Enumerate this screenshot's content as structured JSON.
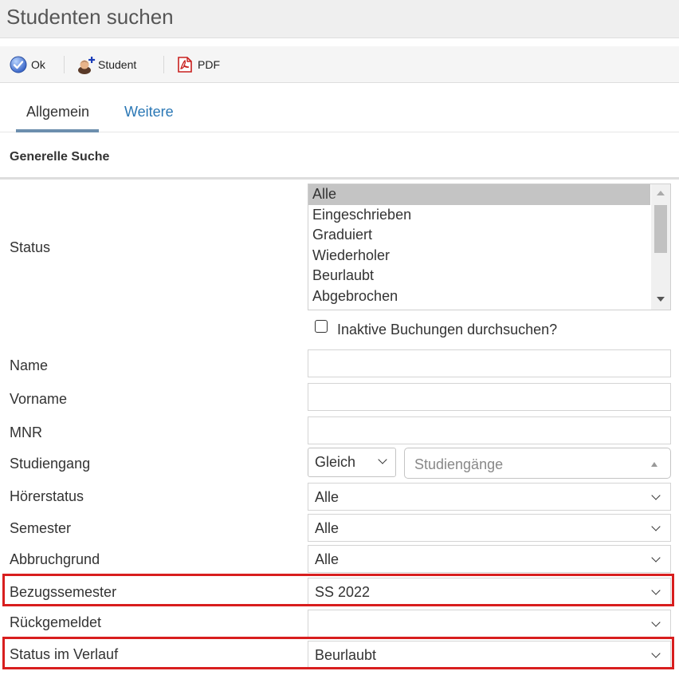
{
  "page": {
    "title": "Studenten suchen"
  },
  "toolbar": {
    "ok_label": "Ok",
    "student_label": "Student",
    "pdf_label": "PDF"
  },
  "icons": {
    "ok": "check-circle-icon",
    "student": "add-student-icon",
    "pdf": "pdf-icon"
  },
  "tabs": [
    {
      "label": "Allgemein",
      "active": true
    },
    {
      "label": "Weitere",
      "active": false
    }
  ],
  "section": {
    "title": "Generelle Suche"
  },
  "status": {
    "label": "Status",
    "options": [
      "Alle",
      "Eingeschrieben",
      "Graduiert",
      "Wiederholer",
      "Beurlaubt",
      "Abgebrochen"
    ],
    "selected": "Alle"
  },
  "inactive_checkbox": {
    "label": "Inaktive Buchungen durchsuchen?",
    "checked": false
  },
  "fields": {
    "name": {
      "label": "Name",
      "value": ""
    },
    "vorname": {
      "label": "Vorname",
      "value": ""
    },
    "mnr": {
      "label": "MNR",
      "value": ""
    },
    "studiengang": {
      "label": "Studiengang",
      "operator": "Gleich",
      "placeholder": "Studiengänge"
    },
    "hoererstatus": {
      "label": "Hörerstatus",
      "value": "Alle"
    },
    "semester": {
      "label": "Semester",
      "value": "Alle"
    },
    "abbruchgrund": {
      "label": "Abbruchgrund",
      "value": "Alle"
    },
    "bezugssemester": {
      "label": "Bezugssemester",
      "value": "SS 2022"
    },
    "rueckgemeldet": {
      "label": "Rückgemeldet",
      "value": ""
    },
    "status_verlauf": {
      "label": "Status im Verlauf",
      "value": "Beurlaubt"
    }
  },
  "colors": {
    "highlight": "#d81e1e",
    "tab_active_underline": "#6d8fae",
    "link": "#2a77b5"
  }
}
